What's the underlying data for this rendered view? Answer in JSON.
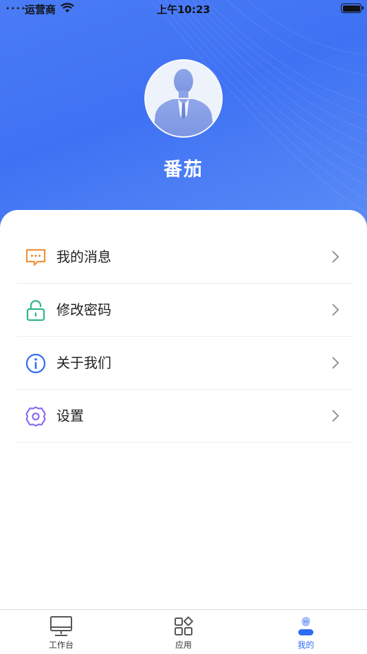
{
  "status_bar": {
    "carrier": "运营商",
    "time": "上午10:23"
  },
  "profile": {
    "name": "番茄"
  },
  "menu": {
    "items": [
      {
        "label": "我的消息",
        "icon": "message-icon",
        "color": "#f0923a"
      },
      {
        "label": "修改密码",
        "icon": "lock-icon",
        "color": "#2fb58a"
      },
      {
        "label": "关于我们",
        "icon": "info-icon",
        "color": "#2e6cf5"
      },
      {
        "label": "设置",
        "icon": "settings-gear-icon",
        "color": "#8a6cf0"
      }
    ]
  },
  "tabbar": {
    "tabs": [
      {
        "label": "工作台",
        "icon": "desktop-icon",
        "active": false
      },
      {
        "label": "应用",
        "icon": "apps-grid-icon",
        "active": false
      },
      {
        "label": "我的",
        "icon": "profile-icon",
        "active": true
      }
    ],
    "active_color": "#2e6cf5"
  },
  "colors": {
    "header_gradient_start": "#4a7cf6",
    "header_gradient_end": "#5b8cf7"
  }
}
